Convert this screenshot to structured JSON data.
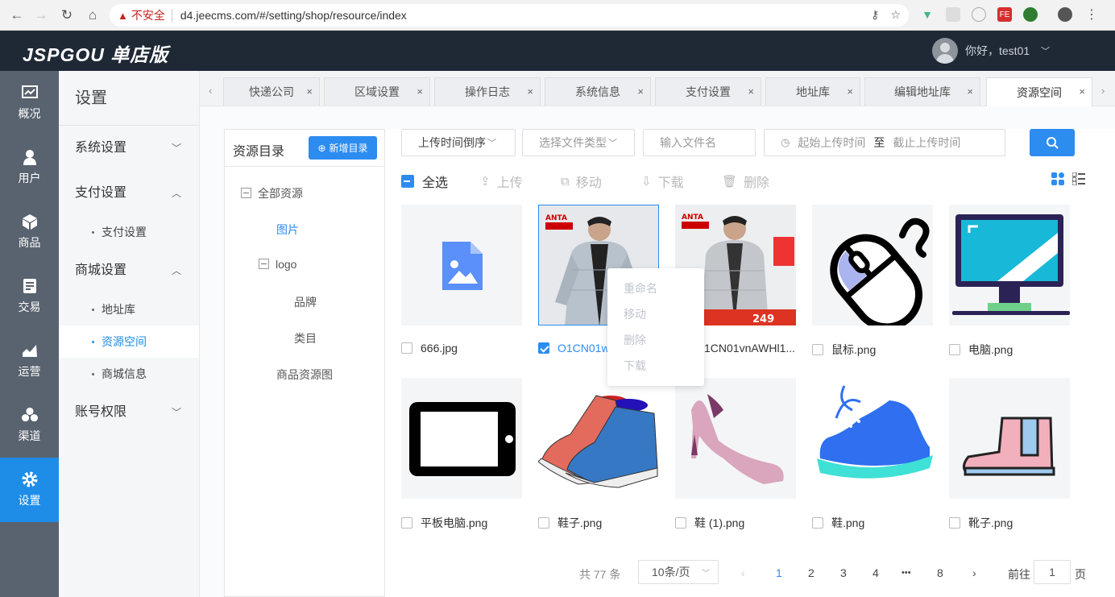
{
  "browser": {
    "insecure_label": "不安全",
    "url": "d4.jeecms.com/#/setting/shop/resource/index"
  },
  "header": {
    "logo": "JSPGOU 单店版",
    "greeting": "你好，test01"
  },
  "iconnav": [
    {
      "label": "概况",
      "icon": "chart-icon"
    },
    {
      "label": "用户",
      "icon": "user-icon"
    },
    {
      "label": "商品",
      "icon": "cube-icon"
    },
    {
      "label": "交易",
      "icon": "document-icon"
    },
    {
      "label": "运营",
      "icon": "trend-icon"
    },
    {
      "label": "渠道",
      "icon": "channel-icon"
    },
    {
      "label": "设置",
      "icon": "gear-icon",
      "active": true
    }
  ],
  "submenu": {
    "title": "设置",
    "groups": [
      {
        "label": "系统设置"
      },
      {
        "label": "支付设置",
        "items": [
          "支付设置"
        ]
      },
      {
        "label": "商城设置",
        "items": [
          "地址库",
          "资源空间",
          "商城信息"
        ]
      },
      {
        "label": "账号权限"
      }
    ]
  },
  "tabs": [
    "快递公司",
    "区域设置",
    "操作日志",
    "系统信息",
    "支付设置",
    "地址库",
    "编辑地址库",
    "资源空间"
  ],
  "tree": {
    "title": "资源目录",
    "add_button": "新增目录",
    "nodes": [
      "全部资源",
      "图片",
      "logo",
      "品牌",
      "类目",
      "商品资源图"
    ]
  },
  "filters": {
    "sort": "上传时间倒序",
    "file_type": "选择文件类型",
    "file_name_placeholder": "输入文件名",
    "start_placeholder": "起始上传时间",
    "range_sep": "至",
    "end_placeholder": "截止上传时间"
  },
  "toolbar": {
    "select_all": "全选",
    "upload": "上传",
    "move": "移动",
    "download": "下载",
    "delete": "删除"
  },
  "files": [
    "666.jpg",
    "O1CN01w",
    "1CN01vnAWHl1...",
    "鼠标.png",
    "电脑.png",
    "平板电脑.png",
    "鞋子.png",
    "鞋 (1).png",
    "鞋.png",
    "靴子.png"
  ],
  "context_menu": [
    "重命名",
    "移动",
    "删除",
    "下载"
  ],
  "pagination": {
    "total": "共 77 条",
    "page_size": "10条/页",
    "pages": [
      "1",
      "2",
      "3",
      "4",
      "•••",
      "8"
    ],
    "goto_label": "前往",
    "goto_value": "1",
    "page_unit": "页"
  }
}
